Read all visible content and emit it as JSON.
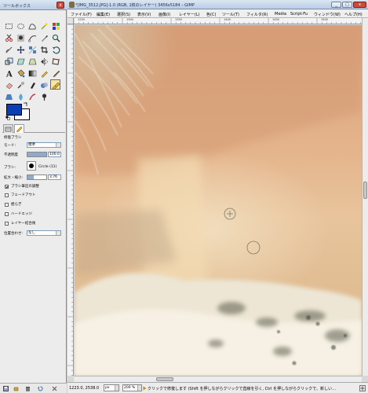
{
  "toolbox": {
    "title": "ツールボックス",
    "close_glyph": "x",
    "tools": [
      "rect-select",
      "ellipse-select",
      "free-select",
      "fuzzy-select",
      "select-by-color",
      "scissors-select",
      "foreground-select",
      "paths",
      "color-picker",
      "zoom",
      "measure",
      "move",
      "align",
      "crop",
      "rotate",
      "scale",
      "shear",
      "perspective",
      "flip",
      "cage-transform",
      "text",
      "bucket-fill",
      "blend",
      "pencil",
      "paintbrush",
      "eraser",
      "airbrush",
      "ink",
      "clone",
      "heal",
      "perspective-clone",
      "blur-sharpen",
      "smudge",
      "dodge-burn"
    ],
    "active_tool_index": 29,
    "colors": {
      "foreground": "#0b3db4",
      "background": "#ffffff"
    },
    "options": {
      "title": "修復ブラシ",
      "mode_label": "モード:",
      "mode_value": "標準",
      "opacity_label": "不透明度",
      "opacity_value": "100.0",
      "brush_label": "ブラシ:",
      "brush_value": "Circle (11)",
      "scale_label": "拡大・縮小:",
      "scale_value": "3.76",
      "checkboxes": [
        {
          "label": "ブラシ筆圧の調整",
          "checked": true
        },
        {
          "label": "フェードアウト",
          "checked": false
        },
        {
          "label": "揺らぎ",
          "checked": false
        },
        {
          "label": "ハードエッジ",
          "checked": false
        },
        {
          "label": "レイヤー結合後",
          "checked": false
        }
      ],
      "align_label": "位置合わせ:",
      "align_value": "なし"
    }
  },
  "image_window": {
    "title": "*[IMG_3512.JPG]-1.0 (RGB, 1枚のレイヤー) 3456x5184 – GIMP",
    "controls": {
      "minimize": "_",
      "maximize": "□",
      "close": "x"
    },
    "menus": [
      "ファイル(F)",
      "編集(E)",
      "選択(S)",
      "表示(V)",
      "画像(I)",
      "レイヤー(L)",
      "色(C)",
      "ツール(T)",
      "フィルタ(R)",
      "Media",
      "Script-Fu",
      "ウィンドウ(W)",
      "ヘルプ(H)"
    ],
    "ruler_labels": [
      "1250",
      "1300",
      "1350",
      "1400",
      "1450",
      "1500"
    ],
    "status": {
      "coords": "1223.0, 2538.0",
      "unit": "px",
      "zoom": "200 %",
      "message": "クリックで修復します (Shift を押しながらクリックで直線を引く, Ctrl を押しながらクリックで、新しい…"
    }
  }
}
